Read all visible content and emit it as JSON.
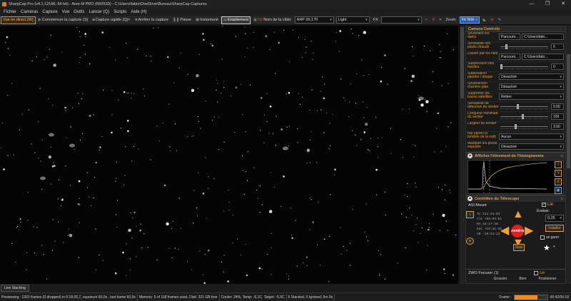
{
  "title": "SharpCap Pro (v4.1.12196, 64 bit) - Ares-M PRO (IMX533) - C:\\Users\\fabio\\OneDrive\\Bureau\\SharpCap Captures",
  "window_buttons": {
    "minimize": "—",
    "maximize": "❐",
    "close": "✕"
  },
  "menu": [
    "Fichier",
    "Caméras",
    "Capture",
    "Vue",
    "Outils",
    "Lancer (Q)",
    "Scripts",
    "Aide (H)"
  ],
  "toolbar": {
    "live_view": "Vue en direct (W)",
    "start_capture": "Commencer la capture (S)",
    "quick_capture": "Capture rapide (Q)",
    "stop_capture": "Arrêter la capture",
    "pause": "Pause",
    "snapshot": "Instantané",
    "stacking": "Empilement",
    "target_label": "Nom de la cible:",
    "target_value": "ARP 99,170",
    "frame_type": "Light",
    "fx_label": "FX",
    "fx_value": "",
    "zoom_label": "Zoom:",
    "zoom_value": "Fit Wid"
  },
  "panel": {
    "section_title": "Camera Controls",
    "controls": [
      {
        "label": "Soustraire les darks",
        "button": "Parcourir...",
        "value": "C:\\Users\\fabi..."
      },
      {
        "label": "Sensibilité des pixels chauds",
        "slider": 0.1,
        "value": "5"
      },
      {
        "label": "Diviser par les flats",
        "button": "Parcourir...",
        "value": "C:\\Users\\fabi..."
      },
      {
        "label": "Suppression des bandes",
        "slider": 0.0,
        "value": "0"
      },
      {
        "label": "Stabilisation planète / disque",
        "select": "Désactivé"
      },
      {
        "label": "Soustraction d'arrière-plan",
        "select": "Désactivé"
      },
      {
        "label": "Supprimer les traces satellites",
        "select": "Retirer"
      },
      {
        "label": "Sensibilité de détection du sentier",
        "slider": 0.35,
        "value": "9.00"
      },
      {
        "label": "Longueur minimale du sentier",
        "slider": 0.45,
        "value": "100"
      },
      {
        "label": "Largeur du sentier",
        "slider": 0.3,
        "value": "3.00"
      },
      {
        "label": "rop (après la tombée de la nuit)",
        "select": "Aucun"
      },
      {
        "label": "Masquer les pixels exposés",
        "select": "Désactivé"
      }
    ],
    "histogram_title": "Afficher l'étirement de l'histogramme",
    "histogram_icons": [
      "info-icon",
      "lightning-icon",
      "target-icon",
      "save-icon"
    ],
    "telescope_title": "Contrôles du Télescope",
    "mount_name": "ASI Mount",
    "linked_label": "Lié",
    "coords": [
      "Az    111:31:03",
      "Alt  +59:04:51",
      "RA     23:17:48",
      "Dec  +19:51:35",
      "AR     -10:51:23"
    ],
    "rate_label": "Évaluer:",
    "rate_value": "0,25",
    "install_label": "Installer",
    "park_label": "se garer",
    "stop_label": "ARRÊTE",
    "follow_label": "Suivi",
    "focuser_name": "ZWO Focuser (1)",
    "focuser_linked": "Lié",
    "focuser_cols": [
      "Grossier",
      "Bien",
      "Positionner"
    ]
  },
  "live_stacking_tab": "Live Stacking",
  "status": {
    "preview": "Previewing : 1301 frames (0 dropped) in 0:18:26,7, exposure 60,0s , last frame 60,0s",
    "memory": "Memory: 5 of 118 frames used, Disk: 321 GB free",
    "cooler": "Cooler: 24%, Temp: -5,1C, Target: -5,0C",
    "stacked": "6 Stacked, 0 Ignored, 6m 0s",
    "frame_label": "Frame :",
    "frame_progress": 0.7,
    "time": "00:42/00:18"
  },
  "colors": {
    "accent": "#f0a030",
    "live_border": "#e08c1e",
    "stop_red": "#e02020",
    "histogram_curve": "#e0c040"
  }
}
